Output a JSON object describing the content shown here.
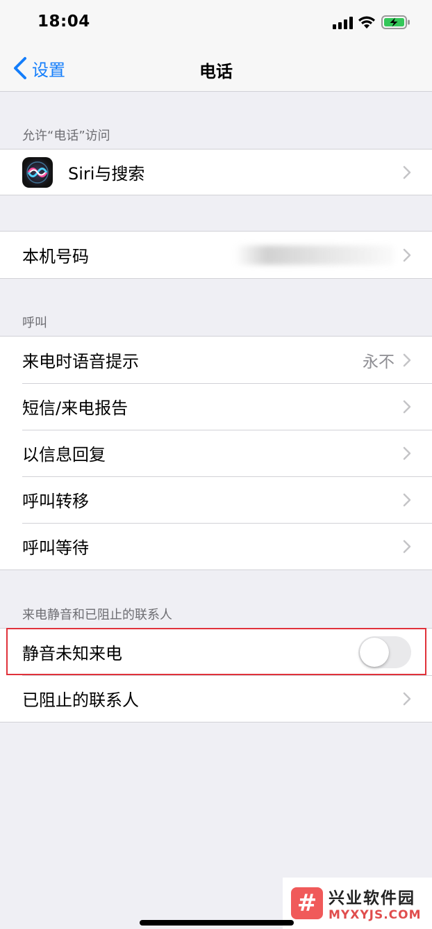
{
  "status_bar": {
    "time": "18:04"
  },
  "nav": {
    "back_label": "设置",
    "title": "电话"
  },
  "sections": {
    "allow_access": {
      "header": "允许“电话”访问",
      "siri_label": "Siri与搜索"
    },
    "my_number": {
      "label": "本机号码"
    },
    "calls": {
      "header": "呼叫",
      "announce_calls": {
        "label": "来电时语音提示",
        "value": "永不"
      },
      "sms_call_reporting": {
        "label": "短信/来电报告"
      },
      "respond_with_text": {
        "label": "以信息回复"
      },
      "call_forwarding": {
        "label": "呼叫转移"
      },
      "call_waiting": {
        "label": "呼叫等待"
      }
    },
    "silence_blocking": {
      "header": "来电静音和已阻止的联系人",
      "silence_unknown": {
        "label": "静音未知来电",
        "enabled": false
      },
      "blocked_contacts": {
        "label": "已阻止的联系人"
      }
    }
  },
  "watermark": {
    "name": "兴业软件园",
    "url": "MYXYJS.COM",
    "logo_glyph": "#"
  },
  "colors": {
    "accent": "#147efb",
    "highlight": "#e0313a",
    "background": "#efeff4"
  }
}
